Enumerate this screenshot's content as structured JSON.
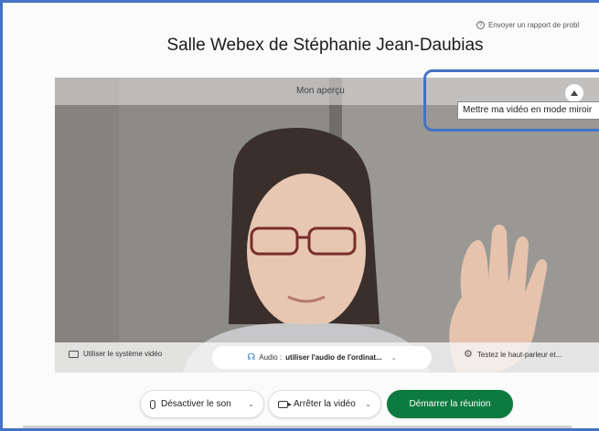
{
  "header": {
    "report_link": "Envoyer un rapport de probl",
    "room_title": "Salle Webex de Stéphanie Jean-Daubias"
  },
  "preview": {
    "label": "Mon aperçu",
    "mirror_tooltip": "Mettre ma vidéo en mode miroir"
  },
  "controls_bar": {
    "system_video": "Utiliser le système vidéo",
    "audio_prefix": "Audio : ",
    "audio_value": "utiliser l'audio de l'ordinat...",
    "test_speaker": "Testez le haut-parleur et..."
  },
  "actions": {
    "mute": "Désactiver le son",
    "stop_video": "Arrêter la vidéo",
    "start_meeting": "Démarrer la réunion"
  },
  "colors": {
    "accent_blue": "#4472c4",
    "start_green": "#0d7a3f"
  },
  "icons": {
    "info": "info-icon",
    "mirror": "mirror-toggle-icon",
    "screen": "screen-icon",
    "headset": "headset-icon",
    "gear": "gear-icon",
    "mic": "microphone-icon",
    "camera": "camera-icon"
  }
}
